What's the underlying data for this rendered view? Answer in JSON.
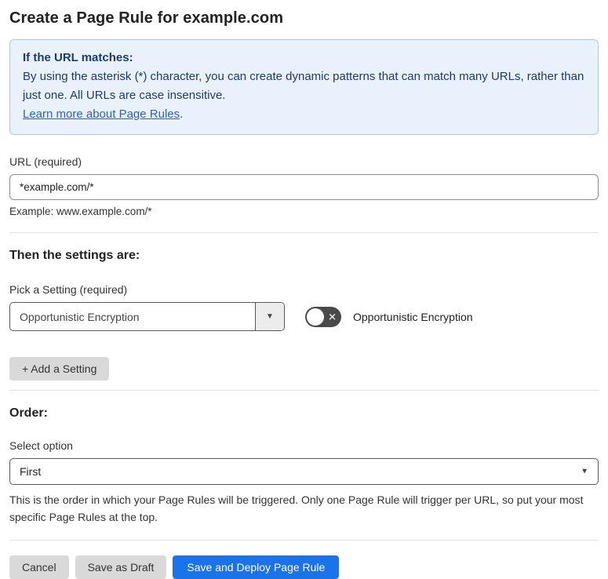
{
  "page": {
    "title": "Create a Page Rule for example.com"
  },
  "info_box": {
    "heading": "If the URL matches:",
    "body": "By using the asterisk (*) character, you can create dynamic patterns that can match many URLs, rather than just one. All URLs are case insensitive.",
    "link_label": "Learn more about Page Rules",
    "link_suffix": "."
  },
  "url_field": {
    "label": "URL (required)",
    "value": "*example.com/*",
    "example": "Example: www.example.com/*"
  },
  "settings_section": {
    "heading": "Then the settings are:",
    "pick_label": "Pick a Setting (required)",
    "selected_setting": "Opportunistic Encryption",
    "toggle_state": "off",
    "toggle_label": "Opportunistic Encryption",
    "add_setting_label": "+ Add a Setting"
  },
  "order_section": {
    "heading": "Order:",
    "select_label": "Select option",
    "selected_option": "First",
    "help_text": "This is the order in which your Page Rules will be triggered. Only one Page Rule will trigger per URL, so put your most specific Page Rules at the top."
  },
  "footer": {
    "cancel_label": "Cancel",
    "save_draft_label": "Save as Draft",
    "save_deploy_label": "Save and Deploy Page Rule"
  },
  "icons": {
    "dropdown_arrow": "▼",
    "toggle_x": "✕"
  },
  "colors": {
    "info_bg": "#e9f2fc",
    "info_border": "#a9c9ec",
    "info_text": "#1e3a6d",
    "link": "#2c5fc7",
    "primary_button": "#1a73e8",
    "gray_button": "#d9d9d9",
    "toggle_off_bg": "#4a4a4a"
  }
}
